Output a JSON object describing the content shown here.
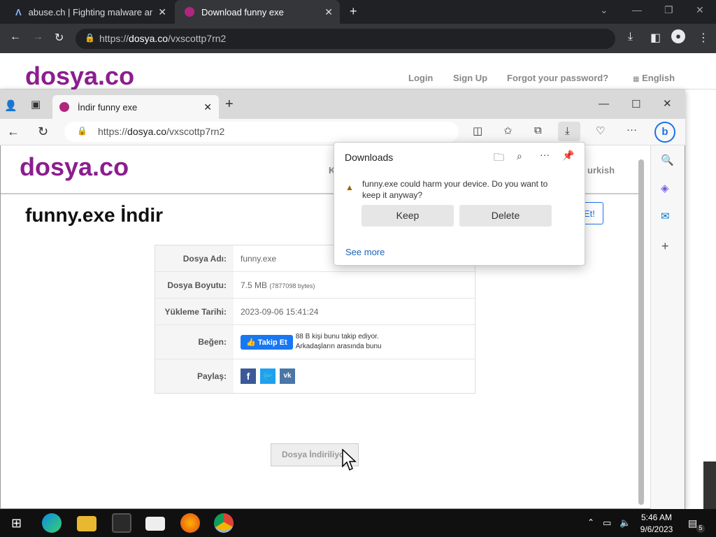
{
  "chrome": {
    "tab1_title": "abuse.ch | Fighting malware and",
    "tab2_title": "Download funny exe",
    "url_prefix": "https://",
    "url_host": "dosya.co",
    "url_path": "/vxscottp7rn2"
  },
  "bg_site": {
    "logo": "dosya.co",
    "nav": [
      "Login",
      "Sign Up",
      "Forgot your password?",
      "English"
    ]
  },
  "edge": {
    "tab_title": "İndir funny exe",
    "url_prefix": "https://",
    "url_host": "dosya.co",
    "url_path": "/vxscottp7rn2"
  },
  "page": {
    "logo": "dosya.co",
    "title": "funny.exe İndir",
    "rows": [
      {
        "key": "Dosya Adı:",
        "value": "funny.exe"
      },
      {
        "key": "Dosya Boyutu:",
        "value": "7.5 MB",
        "extra": "(7877098 bytes)"
      },
      {
        "key": "Yükleme Tarihi:",
        "value": "2023-09-06 15:41:24"
      },
      {
        "key": "Beğen:",
        "like_label": "Takip Et",
        "like_text1": "88 B kişi bunu takip ediyor.",
        "like_text2": "Arkadaşların arasında bunu"
      },
      {
        "key": "Paylaş:"
      }
    ],
    "download_button": "Dosya İndiriliyor",
    "partial_nav": "K",
    "partial_lang": "urkish",
    "partial_btn": "Et!"
  },
  "downloads": {
    "title": "Downloads",
    "warning_line1": "funny.exe could harm your device. Do you want to",
    "warning_line2": "keep it anyway?",
    "keep": "Keep",
    "delete": "Delete",
    "see_more": "See more"
  },
  "taskbar": {
    "time": "5:46 AM",
    "date": "9/6/2023",
    "notifications": "5"
  },
  "colors": {
    "logo": "#8b1e8e",
    "accent": "#1a73e8",
    "warning": "#9c6500"
  }
}
